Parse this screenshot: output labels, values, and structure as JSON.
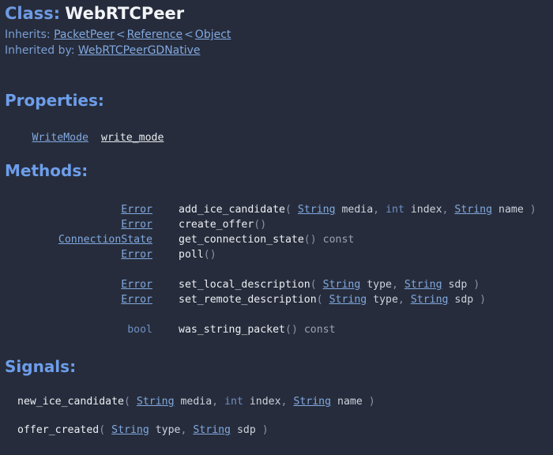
{
  "header": {
    "class_keyword": "Class:",
    "class_name": "WebRTCPeer",
    "inherits_label": "Inherits:",
    "inherits_chain": [
      "PacketPeer",
      "Reference",
      "Object"
    ],
    "inherits_separator": "<",
    "inherited_by_label": "Inherited by:",
    "inherited_by": [
      "WebRTCPeerGDNative"
    ]
  },
  "sections": {
    "properties_title": "Properties:",
    "methods_title": "Methods:",
    "signals_title": "Signals:"
  },
  "properties": [
    {
      "type": "WriteMode",
      "name": "write_mode"
    }
  ],
  "methods": [
    {
      "return_type": "Error",
      "return_is_link": true,
      "name": "add_ice_candidate",
      "open": "(",
      "args": [
        {
          "type": "String",
          "type_is_link": true,
          "name": "media"
        },
        {
          "type": "int",
          "type_is_link": false,
          "name": "index"
        },
        {
          "type": "String",
          "type_is_link": true,
          "name": "name"
        }
      ],
      "close": ")",
      "qualifier": ""
    },
    {
      "return_type": "Error",
      "return_is_link": true,
      "name": "create_offer",
      "open": "(",
      "args": [],
      "close": ")",
      "qualifier": ""
    },
    {
      "return_type": "ConnectionState",
      "return_is_link": true,
      "name": "get_connection_state",
      "open": "(",
      "args": [],
      "close": ")",
      "qualifier": "const"
    },
    {
      "return_type": "Error",
      "return_is_link": true,
      "name": "poll",
      "open": "(",
      "args": [],
      "close": ")",
      "qualifier": ""
    },
    {
      "spacer": true
    },
    {
      "return_type": "Error",
      "return_is_link": true,
      "name": "set_local_description",
      "open": "(",
      "args": [
        {
          "type": "String",
          "type_is_link": true,
          "name": "type"
        },
        {
          "type": "String",
          "type_is_link": true,
          "name": "sdp"
        }
      ],
      "close": ")",
      "qualifier": ""
    },
    {
      "return_type": "Error",
      "return_is_link": true,
      "name": "set_remote_description",
      "open": "(",
      "args": [
        {
          "type": "String",
          "type_is_link": true,
          "name": "type"
        },
        {
          "type": "String",
          "type_is_link": true,
          "name": "sdp"
        }
      ],
      "close": ")",
      "qualifier": ""
    },
    {
      "spacer": true
    },
    {
      "return_type": "bool",
      "return_is_link": false,
      "name": "was_string_packet",
      "open": "(",
      "args": [],
      "close": ")",
      "qualifier": "const"
    }
  ],
  "signals": [
    {
      "name": "new_ice_candidate",
      "open": "(",
      "args": [
        {
          "type": "String",
          "type_is_link": true,
          "name": "media"
        },
        {
          "type": "int",
          "type_is_link": false,
          "name": "index"
        },
        {
          "type": "String",
          "type_is_link": true,
          "name": "name"
        }
      ],
      "close": ")"
    },
    {
      "spacer": true
    },
    {
      "name": "offer_created",
      "open": "(",
      "args": [
        {
          "type": "String",
          "type_is_link": true,
          "name": "type"
        },
        {
          "type": "String",
          "type_is_link": true,
          "name": "sdp"
        }
      ],
      "close": ")"
    }
  ],
  "colors": {
    "background": "#262c3b",
    "accent_blue": "#6d9eeb",
    "link_blue": "#82a9e0",
    "text_white": "#edeff4",
    "muted": "#8b93a8"
  }
}
